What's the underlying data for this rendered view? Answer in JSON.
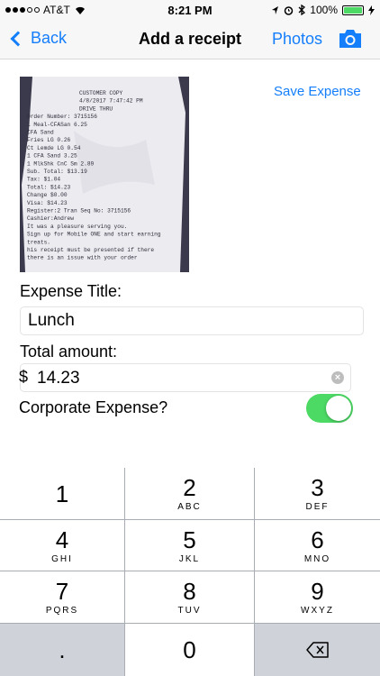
{
  "status": {
    "carrier": "AT&T",
    "time": "8:21 PM",
    "battery": "100%"
  },
  "nav": {
    "back_label": "Back",
    "title": "Add a receipt",
    "photos_label": "Photos"
  },
  "actions": {
    "save_label": "Save Expense"
  },
  "form": {
    "title_label": "Expense Title:",
    "title_value": "Lunch",
    "amount_label": "Total amount:",
    "currency_symbol": "$",
    "amount_value": "14.23",
    "corporate_label": "Corporate Expense?",
    "corporate_on": true
  },
  "receipt": {
    "lines": [
      "CUSTOMER COPY",
      "4/8/2017 7:47:42 PM",
      "DRIVE THRU",
      "Order Number:  3715156",
      "1 Meal-CFASan           6.25",
      "  CFA Sand",
      "  Fries LG              0.26",
      "  Ct Lemde LG           0.54",
      "1 CFA Sand              3.25",
      "1 MlkShk CnC Sm         2.89",
      "Sub. Total:           $13.19",
      "Tax:                   $1.04",
      "Total:                $14.23",
      "Change                 $0.00",
      "Visa:                 $14.23",
      "Register:2   Tran Seq No: 3715156",
      "Cashier:Andrew",
      "It was a pleasure serving you.",
      "Sign up for Mobile ONE and start earning",
      "treats.",
      "his receipt must be presented if there",
      "there is an issue with your order"
    ]
  },
  "keypad": {
    "keys": [
      {
        "num": "1",
        "letters": ""
      },
      {
        "num": "2",
        "letters": "ABC"
      },
      {
        "num": "3",
        "letters": "DEF"
      },
      {
        "num": "4",
        "letters": "GHI"
      },
      {
        "num": "5",
        "letters": "JKL"
      },
      {
        "num": "6",
        "letters": "MNO"
      },
      {
        "num": "7",
        "letters": "PQRS"
      },
      {
        "num": "8",
        "letters": "TUV"
      },
      {
        "num": "9",
        "letters": "WXYZ"
      },
      {
        "num": ".",
        "letters": ""
      },
      {
        "num": "0",
        "letters": ""
      }
    ]
  },
  "icons": {
    "back": "chevron-left-icon",
    "camera": "camera-icon",
    "clear": "clear-icon",
    "delete": "backspace-icon"
  },
  "colors": {
    "accent": "#147efb",
    "toggle_on": "#4cd964",
    "battery": "#4cd964"
  }
}
